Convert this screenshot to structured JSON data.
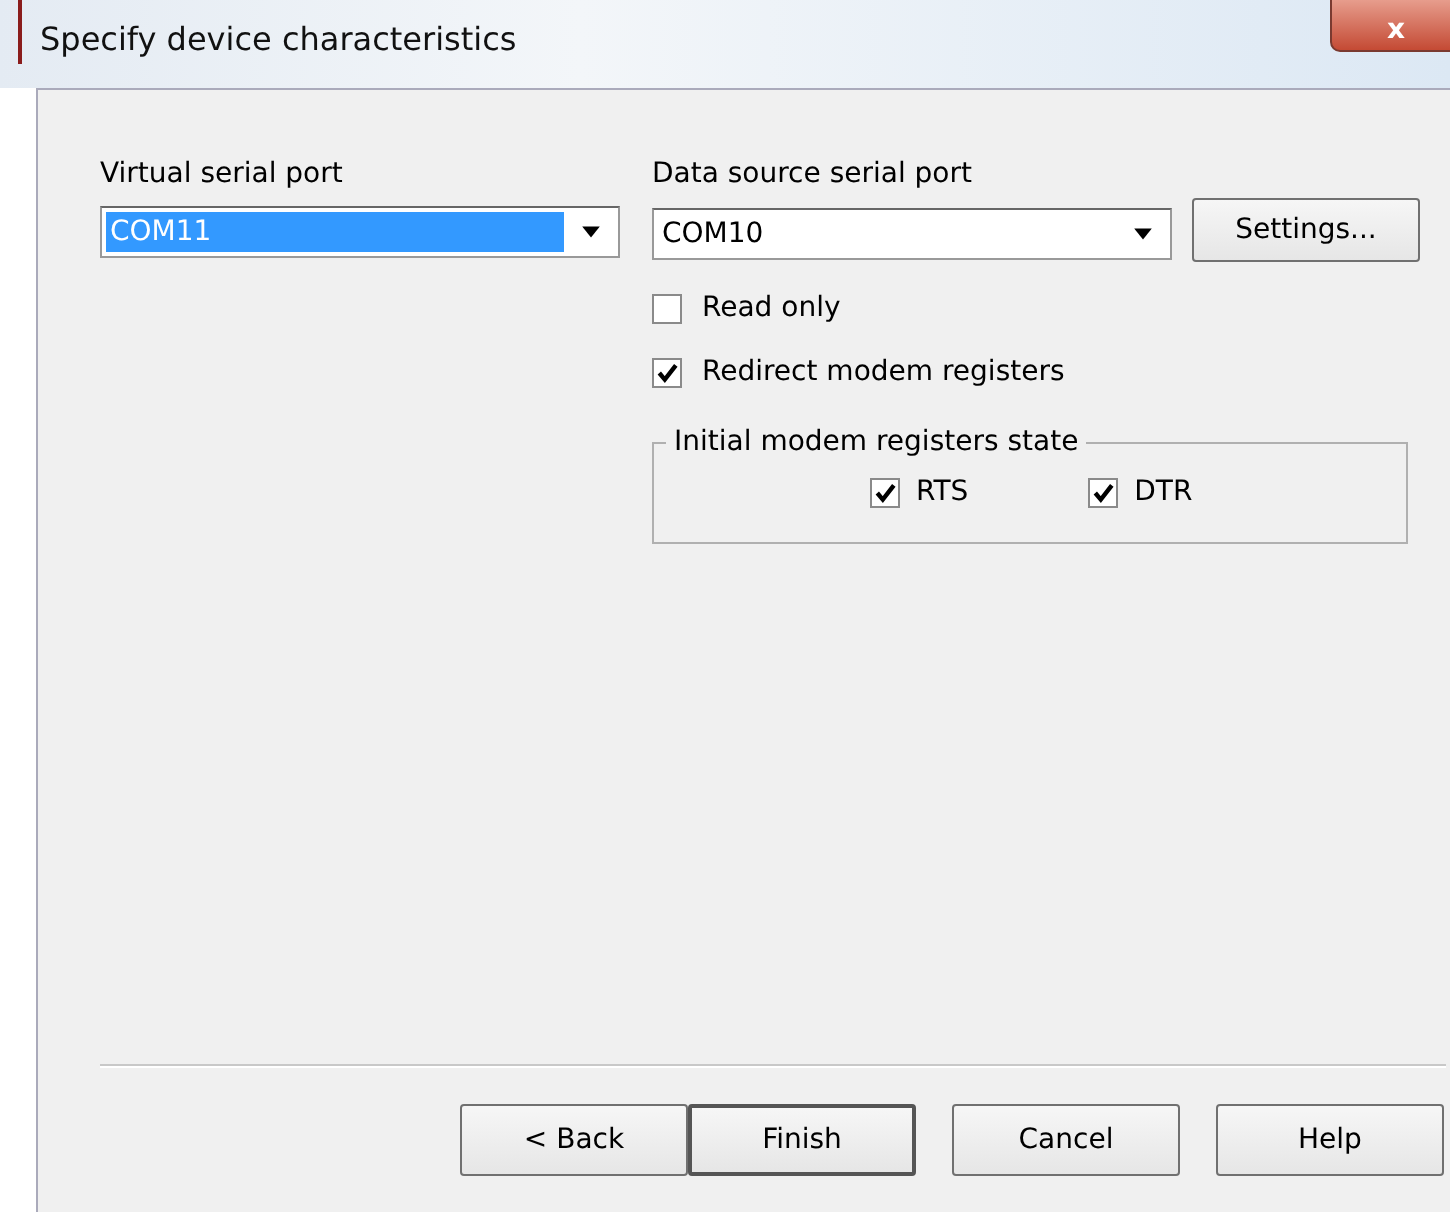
{
  "window": {
    "title": "Specify device characteristics",
    "close": "x"
  },
  "virtual_port": {
    "label": "Virtual serial port",
    "value": "COM11",
    "selected": true
  },
  "source_port": {
    "label": "Data source serial port",
    "value": "COM10",
    "selected": false
  },
  "settings_button": "Settings...",
  "options": [
    {
      "label": "Read only",
      "checked": false
    },
    {
      "label": "Redirect modem registers",
      "checked": true
    }
  ],
  "group": {
    "title": "Initial modem registers state",
    "items": [
      {
        "label": "RTS",
        "checked": true
      },
      {
        "label": "DTR",
        "checked": true
      }
    ]
  },
  "buttons": [
    {
      "label": "< Back",
      "default": false
    },
    {
      "label": "Finish",
      "default": true
    },
    {
      "label": "Cancel",
      "default": false
    },
    {
      "label": "Help",
      "default": false
    }
  ]
}
